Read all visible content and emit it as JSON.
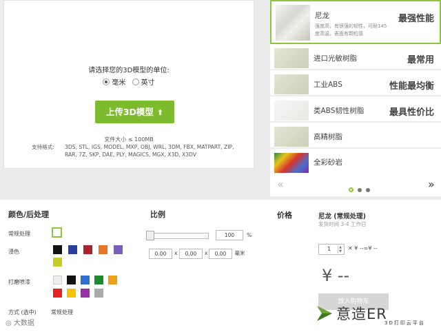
{
  "upload": {
    "unit_prompt": "请选择您的3D模型的单位:",
    "units": [
      "毫米",
      "英寸"
    ],
    "selected_unit": "毫米",
    "button_label": "上传3D模型",
    "size_limit": "文件大小 ≤ 100MB",
    "formats_label": "支持格式:",
    "formats_line1": "3DS, STL, IGS, MODEL, MXP, OBJ, WRL, 3DM, FBX, MATPART, ZIP,",
    "formats_line2": "RAR, 7Z, SKP, DAE, PLY, MAGICS, MGX, X3D, X3DV"
  },
  "materials": [
    {
      "name": "尼龙",
      "tag": "最强性能",
      "desc1": "强度高，有很强的韧性，可耐145",
      "desc2": "度高温，表面有颗粒感",
      "selected": true
    },
    {
      "name": "进口光敏树脂",
      "tag": "最常用"
    },
    {
      "name": "工业ABS",
      "tag": "性能最均衡"
    },
    {
      "name": "类ABS韧性树脂",
      "tag": "最具性价比"
    },
    {
      "name": "高精树脂",
      "tag": ""
    },
    {
      "name": "全彩砂岩",
      "tag": ""
    }
  ],
  "carousel": {
    "prev": "«",
    "next": "»"
  },
  "settings": {
    "color_title": "颜色/后处理",
    "row_regular": "常规处理",
    "row_dye": "浸色",
    "row_paint": "打磨喷漆",
    "dye_colors": [
      "#111111",
      "#2a3e9e",
      "#a8232b",
      "#e8742a",
      "#7b5fbf",
      "#c5cc2a"
    ],
    "paint_colors": [
      "#eeeeea",
      "#111111",
      "#2c6fd0",
      "#1d8a2f",
      "#f0a018",
      "#e62222",
      "#f5c400",
      "#9b2fa8",
      "#aaaaaa"
    ],
    "method_label": "方式 (选中)",
    "method_value": "常规处理"
  },
  "scale": {
    "title": "比例",
    "percent": "100",
    "percent_unit": "%",
    "dims": [
      "0.00",
      "0.00",
      "0.00"
    ],
    "dim_sep": "x",
    "dim_unit": "毫米"
  },
  "price": {
    "title": "价格",
    "material_name": "尼龙 (常规处理)",
    "ship_time": "发货时间 3-4 工作日",
    "quantity": "1",
    "formula": "✕ ¥ --=¥ --",
    "total": "¥ --",
    "cart_label": "放入购物车"
  },
  "watermark": {
    "left_text": "大数据",
    "right_title": "意造ER",
    "right_sub": "3D打印云平台"
  }
}
